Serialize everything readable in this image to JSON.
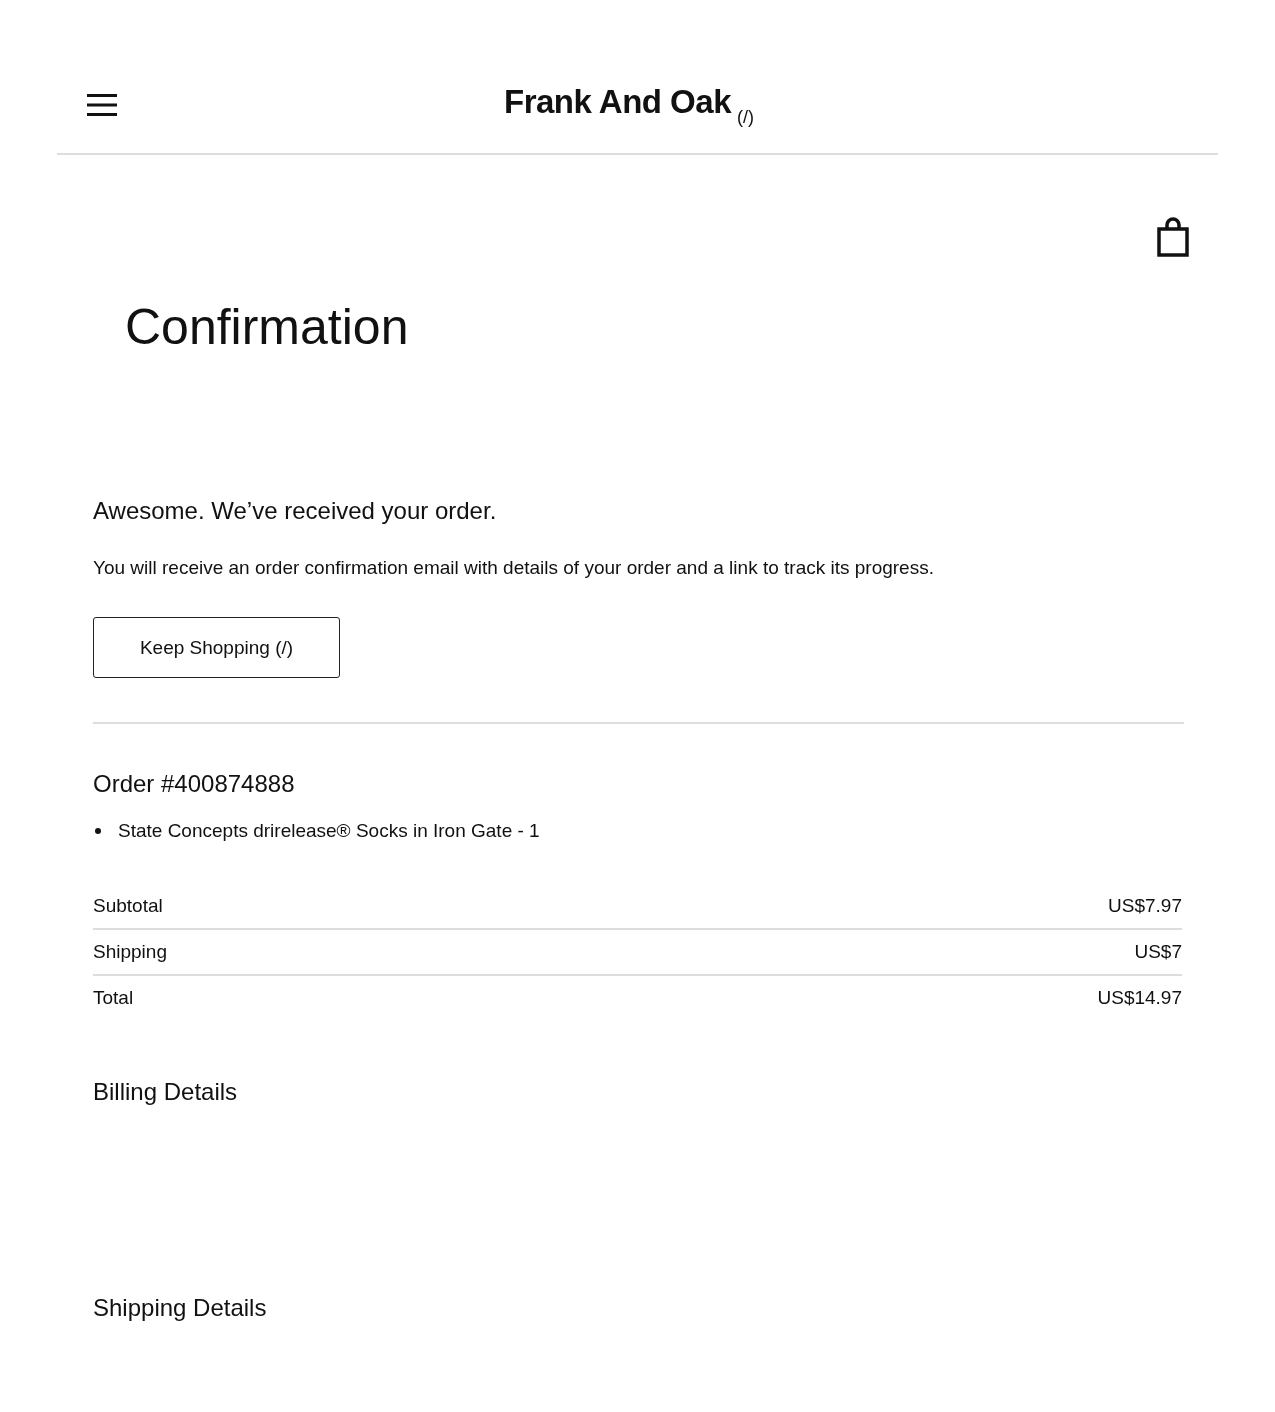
{
  "header": {
    "logo": "Frank And Oak",
    "logo_suffix": "(/)"
  },
  "page_title": "Confirmation",
  "message": {
    "heading": "Awesome. We’ve received your order.",
    "body": "You will receive an order confirmation email with details of your order and a link to track its progress."
  },
  "keep_shopping_button": "Keep Shopping (/)",
  "order": {
    "title": "Order #400874888",
    "items": [
      "State Concepts drirelease® Socks in Iron Gate - 1"
    ],
    "totals": [
      {
        "label": "Subtotal",
        "value": "US$7.97"
      },
      {
        "label": "Shipping",
        "value": "US$7"
      },
      {
        "label": "Total",
        "value": "US$14.97"
      }
    ]
  },
  "sections": [
    "Billing Details",
    "Shipping Details"
  ]
}
